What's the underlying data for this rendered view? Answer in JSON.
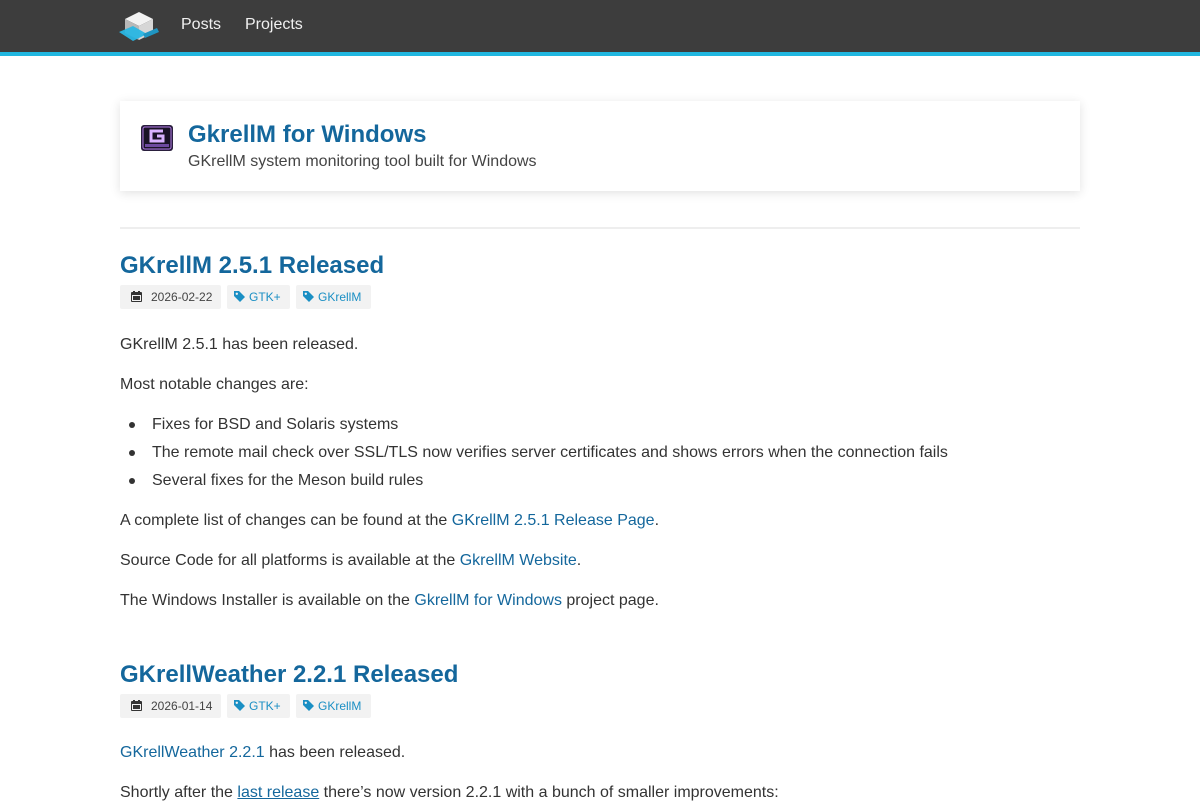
{
  "nav": {
    "logo_icon": "cube-logo-icon",
    "items": [
      {
        "label": "Posts"
      },
      {
        "label": "Projects"
      }
    ]
  },
  "project": {
    "icon": "gkrellm-app-icon",
    "title": "GkrellM for Windows",
    "subtitle": "GKrellM system monitoring tool built for Windows"
  },
  "posts": [
    {
      "title": "GKrellM 2.5.1 Released",
      "date": "2026-02-22",
      "tags": [
        "GTK+",
        "GKrellM"
      ],
      "p1": "GKrellM 2.5.1 has been released.",
      "p2": "Most notable changes are:",
      "bullets": [
        "Fixes for BSD and Solaris systems",
        "The remote mail check over SSL/TLS now verifies server certificates and shows errors when the connection fails",
        "Several fixes for the Meson build rules"
      ],
      "p3": {
        "before": "A complete list of changes can be found at the ",
        "link": "GKrellM 2.5.1 Release Page",
        "after": "."
      },
      "p4": {
        "before": "Source Code for all platforms is available at the ",
        "link": "GkrellM Website",
        "after": "."
      },
      "p5": {
        "before": "The Windows Installer is available on the ",
        "link": "GkrellM for Windows",
        "after": " project page."
      }
    },
    {
      "title": "GKrellWeather 2.2.1 Released",
      "date": "2026-01-14",
      "tags": [
        "GTK+",
        "GKrellM"
      ],
      "p1": {
        "link": "GKrellWeather 2.2.1",
        "after": " has been released."
      },
      "p2": {
        "before": "Shortly after the ",
        "link": "last release",
        "after": " there’s now version 2.2.1 with a bunch of smaller improvements:"
      }
    }
  ],
  "icons": {
    "date": "calendar-icon",
    "tag": "tag-icon"
  },
  "colors": {
    "nav_bg": "#3d3d3d",
    "nav_accent": "#21b7e0",
    "link": "#14679c",
    "tag_text": "#1a8fc4"
  }
}
